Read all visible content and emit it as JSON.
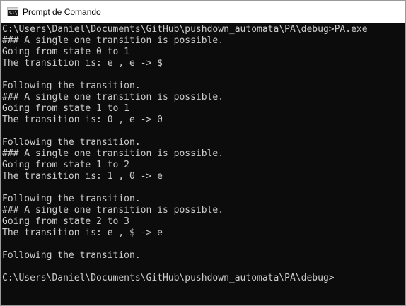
{
  "window": {
    "title": "Prompt de Comando",
    "icon": "cmd-icon",
    "icon_glyph": "C:\\"
  },
  "console": {
    "lines": [
      "C:\\Users\\Daniel\\Documents\\GitHub\\pushdown_automata\\PA\\debug>PA.exe",
      "### A single one transition is possible.",
      "Going from state 0 to 1",
      "The transition is: e , e -> $",
      "",
      "Following the transition.",
      "### A single one transition is possible.",
      "Going from state 1 to 1",
      "The transition is: 0 , e -> 0",
      "",
      "Following the transition.",
      "### A single one transition is possible.",
      "Going from state 1 to 2",
      "The transition is: 1 , 0 -> e",
      "",
      "Following the transition.",
      "### A single one transition is possible.",
      "Going from state 2 to 3",
      "The transition is: e , $ -> e",
      "",
      "Following the transition.",
      "",
      "C:\\Users\\Daniel\\Documents\\GitHub\\pushdown_automata\\PA\\debug>"
    ]
  },
  "colors": {
    "background": "#0c0c0c",
    "foreground": "#cccccc",
    "titlebar": "#ffffff"
  }
}
